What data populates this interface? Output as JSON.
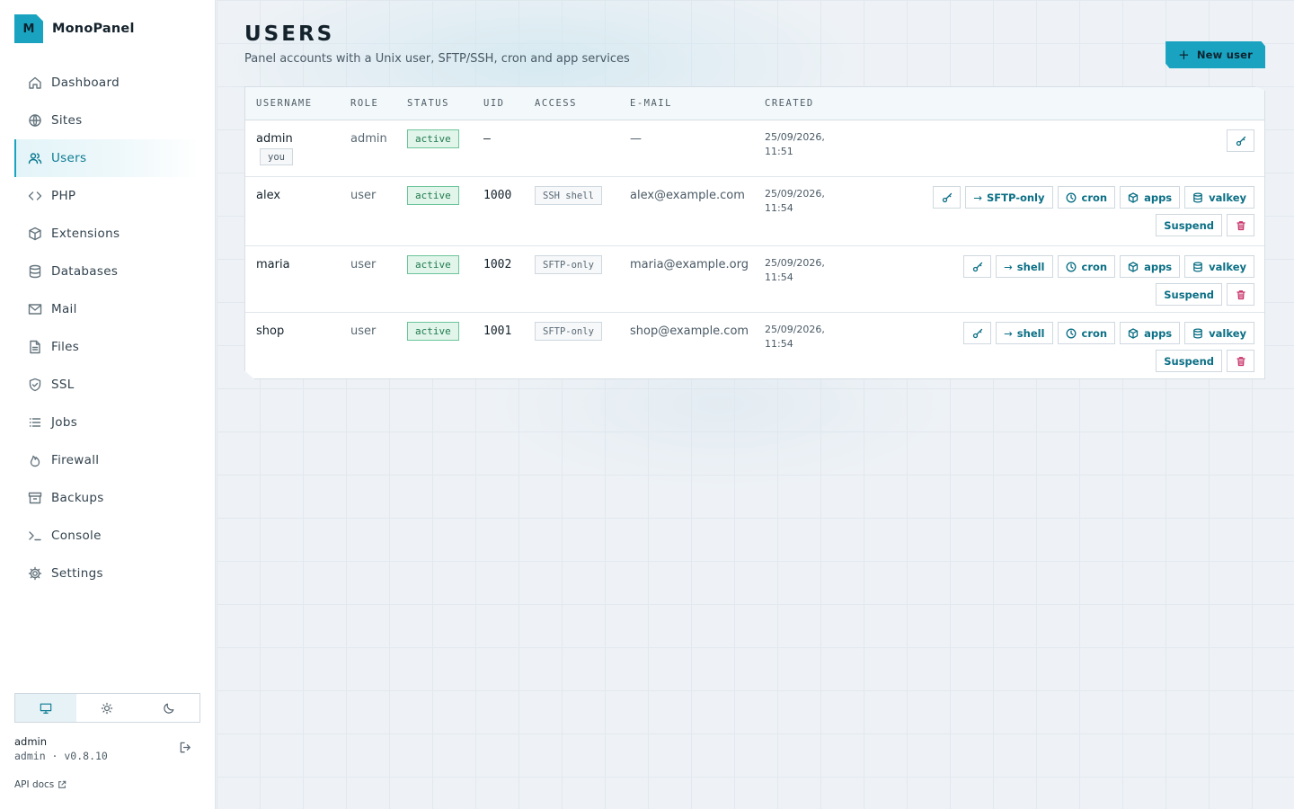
{
  "app": {
    "logo_letter": "M",
    "name": "MonoPanel",
    "accent": "#1aa3c0"
  },
  "sidebar": {
    "items": [
      {
        "label": "Dashboard",
        "icon": "home-icon"
      },
      {
        "label": "Sites",
        "icon": "globe-icon"
      },
      {
        "label": "Users",
        "icon": "users-icon",
        "active": true
      },
      {
        "label": "PHP",
        "icon": "code-icon"
      },
      {
        "label": "Extensions",
        "icon": "cube-icon"
      },
      {
        "label": "Databases",
        "icon": "database-icon"
      },
      {
        "label": "Mail",
        "icon": "mail-icon"
      },
      {
        "label": "Files",
        "icon": "file-icon"
      },
      {
        "label": "SSL",
        "icon": "shield-icon"
      },
      {
        "label": "Jobs",
        "icon": "list-icon"
      },
      {
        "label": "Firewall",
        "icon": "flame-icon"
      },
      {
        "label": "Backups",
        "icon": "archive-icon"
      },
      {
        "label": "Console",
        "icon": "terminal-icon"
      },
      {
        "label": "Settings",
        "icon": "gear-icon"
      }
    ],
    "theme_modes": [
      "system",
      "light",
      "dark"
    ],
    "theme_selected": "system",
    "user": {
      "name": "admin",
      "meta": "admin · v0.8.10"
    },
    "api_docs_label": "API docs"
  },
  "page": {
    "title": "USERS",
    "subtitle": "Panel accounts with a Unix user, SFTP/SSH, cron and app services",
    "new_user_label": "New user"
  },
  "table": {
    "columns": [
      "USERNAME",
      "ROLE",
      "STATUS",
      "UID",
      "ACCESS",
      "E-MAIL",
      "CREATED"
    ],
    "rows": [
      {
        "username": "admin",
        "you_badge": "you",
        "role": "admin",
        "status": "active",
        "uid": "—",
        "access": "",
        "email": "—",
        "created_date": "25/09/2026,",
        "created_time": "11:51",
        "actions": {
          "access_toggle": "",
          "cron": "",
          "apps": "",
          "valkey": "",
          "suspend": ""
        }
      },
      {
        "username": "alex",
        "you_badge": "",
        "role": "user",
        "status": "active",
        "uid": "1000",
        "access": "SSH shell",
        "email": "alex@example.com",
        "created_date": "25/09/2026,",
        "created_time": "11:54",
        "actions": {
          "access_toggle": "SFTP-only",
          "cron": "cron",
          "apps": "apps",
          "valkey": "valkey",
          "suspend": "Suspend"
        }
      },
      {
        "username": "maria",
        "you_badge": "",
        "role": "user",
        "status": "active",
        "uid": "1002",
        "access": "SFTP-only",
        "email": "maria@example.org",
        "created_date": "25/09/2026,",
        "created_time": "11:54",
        "actions": {
          "access_toggle": "shell",
          "cron": "cron",
          "apps": "apps",
          "valkey": "valkey",
          "suspend": "Suspend"
        }
      },
      {
        "username": "shop",
        "you_badge": "",
        "role": "user",
        "status": "active",
        "uid": "1001",
        "access": "SFTP-only",
        "email": "shop@example.com",
        "created_date": "25/09/2026,",
        "created_time": "11:54",
        "actions": {
          "access_toggle": "shell",
          "cron": "cron",
          "apps": "apps",
          "valkey": "valkey",
          "suspend": "Suspend"
        }
      }
    ]
  }
}
